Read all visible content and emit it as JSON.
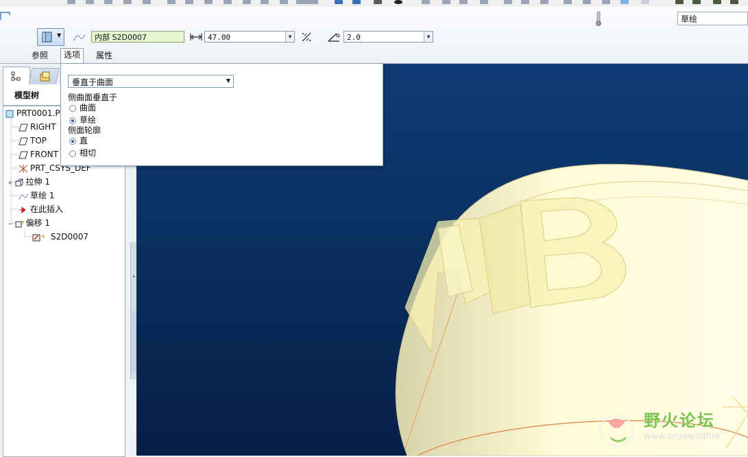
{
  "dashboard": {
    "search_value": "草绘",
    "ref_label": "内部 S2D0007",
    "depth_value": "47.00",
    "angle_value": "2.0",
    "tabs": [
      "参照",
      "选项",
      "属性"
    ],
    "active_tab": "选项"
  },
  "tree": {
    "tab_label": "模型树",
    "items": [
      {
        "label": "PRT0001.P",
        "icon": "part-icon"
      },
      {
        "label": "RIGHT",
        "icon": "datum-plane-icon"
      },
      {
        "label": "TOP",
        "icon": "datum-plane-icon"
      },
      {
        "label": "FRONT",
        "icon": "datum-plane-icon"
      },
      {
        "label": "PRT_CSYS_DEF",
        "icon": "csys-icon"
      },
      {
        "label": "拉伸 1",
        "icon": "extrude-icon"
      },
      {
        "label": "草绘 1",
        "icon": "sketch-icon"
      },
      {
        "label": "在此插入",
        "icon": "insert-arrow-icon"
      },
      {
        "label": "偏移 1",
        "icon": "offset-icon"
      },
      {
        "label": "S2D0007",
        "icon": "sketch-edit-icon"
      }
    ]
  },
  "options": {
    "select_value": "垂直于曲面",
    "side_normal_label": "侧曲面垂直于",
    "side_normal_options": [
      "曲面",
      "草绘"
    ],
    "side_normal_selected": "草绘",
    "profile_label": "侧面轮廓",
    "profile_options": [
      "直",
      "相切"
    ],
    "profile_selected": "直"
  },
  "watermark": {
    "title": "野火论坛",
    "url": "www.proewildfire"
  },
  "colors": {
    "viewport_top": "#0f3c75",
    "viewport_bottom": "#061f47",
    "model_fill": "#fffbd0",
    "model_edge": "#e8b070",
    "field_green": "#e6f6d3"
  }
}
